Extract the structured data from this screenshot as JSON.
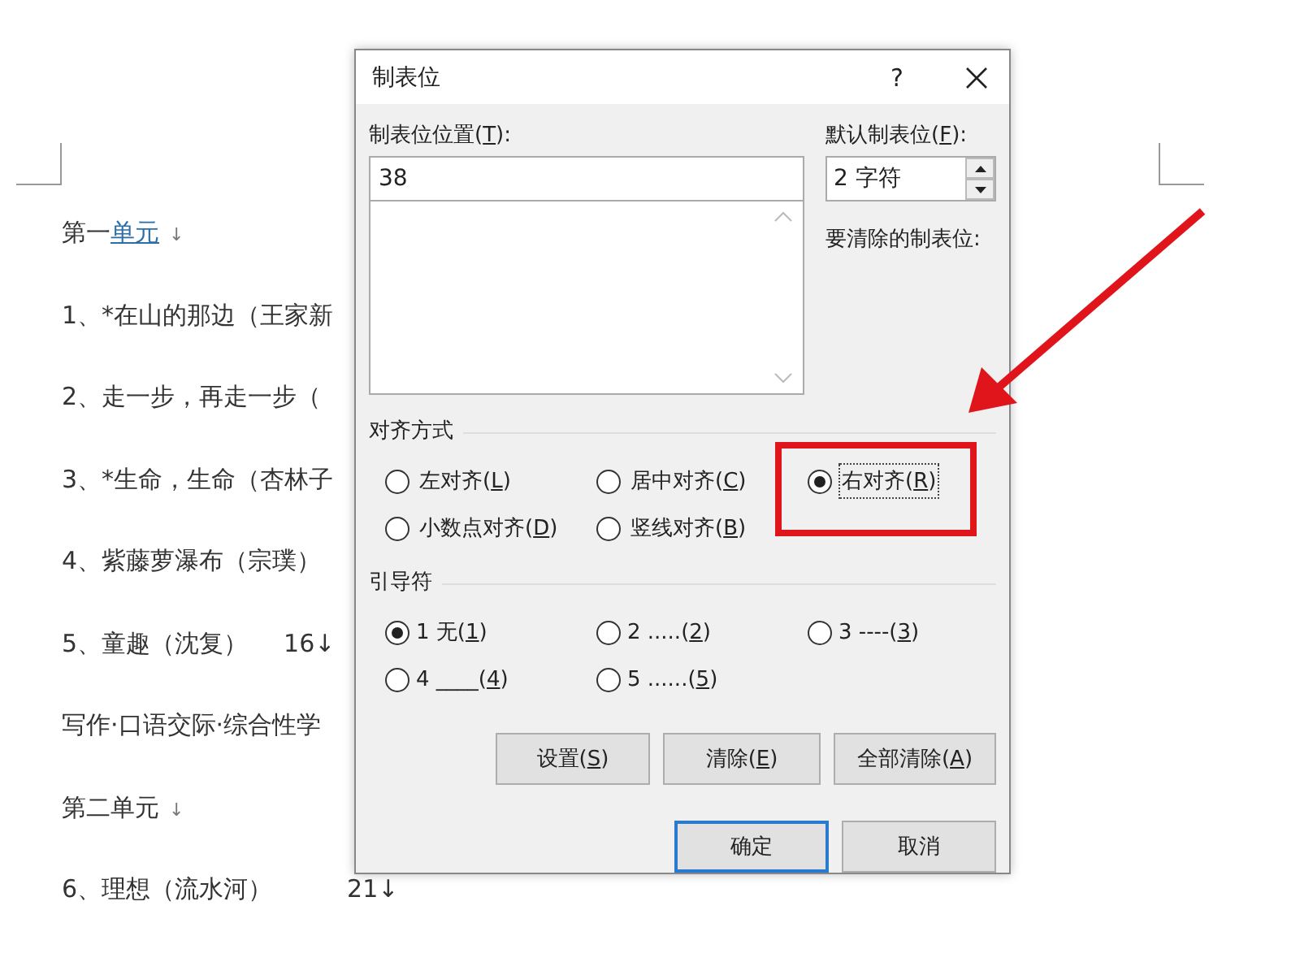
{
  "document": {
    "lines": [
      {
        "text": "第一",
        "underlined": "单元",
        "mark": "↓"
      },
      {
        "text": "1、*在山的那边（王家新"
      },
      {
        "text": "2、走一步，再走一步（"
      },
      {
        "text": "3、*生命，生命（杏林子"
      },
      {
        "text": "4、紫藤萝瀑布（宗璞）"
      },
      {
        "text": "5、童趣（沈复）",
        "page": "16↓"
      },
      {
        "text": "写作·口语交际·综合性学"
      },
      {
        "text": "第二单元",
        "mark": "↓"
      },
      {
        "text": "6、理想（流水河）",
        "page": "21↓"
      }
    ]
  },
  "dialog": {
    "title": "制表位",
    "help": "?",
    "position": {
      "label": [
        "制表位位置(",
        "T",
        "):"
      ],
      "value": "38"
    },
    "default_tabs": {
      "label": [
        "默认制表位(",
        "F",
        "):"
      ],
      "value": "2 字符"
    },
    "clear_label": "要清除的制表位:",
    "alignment": {
      "title": "对齐方式",
      "options": [
        {
          "label": [
            "左对齐(",
            "L",
            ")"
          ],
          "selected": false,
          "focused": false
        },
        {
          "label": [
            "居中对齐(",
            "C",
            ")"
          ],
          "selected": false,
          "focused": false
        },
        {
          "label": [
            "右对齐(",
            "R",
            ")"
          ],
          "selected": true,
          "focused": true
        },
        {
          "label": [
            "小数点对齐(",
            "D",
            ")"
          ],
          "selected": false,
          "focused": false
        },
        {
          "label": [
            "竖线对齐(",
            "B",
            ")"
          ],
          "selected": false,
          "focused": false
        }
      ]
    },
    "leader": {
      "title": "引导符",
      "options": [
        {
          "label": [
            "1 无(",
            "1",
            ")"
          ],
          "selected": true
        },
        {
          "label": [
            "2 .....(",
            "2",
            ")"
          ],
          "selected": false
        },
        {
          "label": [
            "3 ----(",
            "3",
            ")"
          ],
          "selected": false
        },
        {
          "label": [
            "4 ____(",
            "4",
            ")"
          ],
          "selected": false
        },
        {
          "label": [
            "5 ......(",
            "5",
            ")"
          ],
          "selected": false
        }
      ]
    },
    "buttons": [
      {
        "label": [
          "设置(",
          "S",
          ")"
        ],
        "default": false
      },
      {
        "label": [
          "清除(",
          "E",
          ")"
        ],
        "default": false
      },
      {
        "label": [
          "全部清除(",
          "A",
          ")"
        ],
        "default": false
      }
    ],
    "footer_buttons": [
      {
        "label": [
          "确定"
        ],
        "default": true
      },
      {
        "label": [
          "取消"
        ],
        "default": false
      }
    ]
  }
}
